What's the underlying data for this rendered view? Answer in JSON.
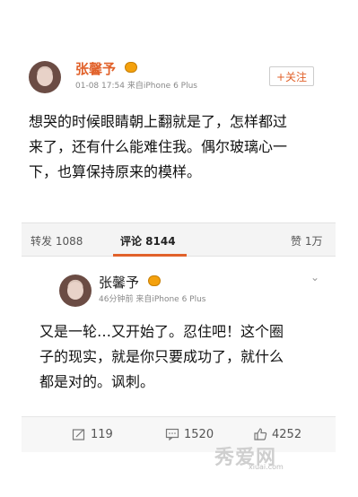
{
  "post1": {
    "username": "张馨予",
    "timestamp": "01-08 17:54",
    "source": "来自iPhone 6 Plus",
    "follow_label": "+关注",
    "text_lines": [
      "想哭的时候眼睛朝上翻就是了，怎样都过",
      "来了，还有什么能难住我。偶尔玻璃心一",
      "下，也算保持原来的模样。"
    ],
    "repost_label": "转发 1088",
    "comment_label": "评论 8144",
    "like_label": "赞 1万"
  },
  "post2": {
    "username": "张馨予",
    "timestamp": "46分钟前",
    "source": "来自iPhone 6 Plus",
    "text_lines": [
      "又是一轮…又开始了。忍住吧！这个圈",
      "子的现实，就是你只要成功了，就什么",
      "都是对的。讽刺。"
    ],
    "repost_count": "119",
    "comment_count": "1520",
    "like_count": "4252"
  },
  "watermark": {
    "main": "秀爱网",
    "sub": "xiuai.com"
  },
  "icons": {
    "vip": "vip-badge-icon",
    "repost": "repost-icon",
    "comment": "comment-icon",
    "like": "thumbs-up-icon",
    "chevron": "chevron-down-icon"
  },
  "colors": {
    "accent": "#e1612a",
    "vip": "#f4a10d"
  }
}
